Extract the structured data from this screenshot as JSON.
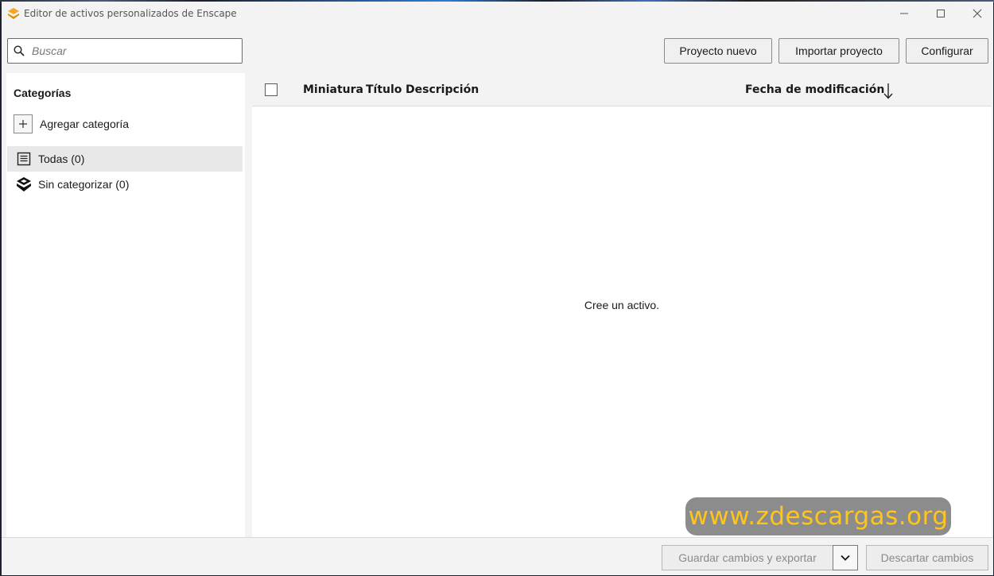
{
  "window": {
    "title": "Editor de activos personalizados de Enscape",
    "accent_color": "#f5a623"
  },
  "toolbar": {
    "search_placeholder": "Buscar",
    "new_project_label": "Proyecto nuevo",
    "import_project_label": "Importar proyecto",
    "configure_label": "Configurar"
  },
  "sidebar": {
    "title": "Categorías",
    "add_category_label": "Agregar categoría",
    "items": [
      {
        "label": "Todas (0)",
        "icon": "list-icon",
        "selected": true
      },
      {
        "label": "Sin categorizar (0)",
        "icon": "enscape-logo-icon",
        "selected": false
      }
    ]
  },
  "table": {
    "columns": [
      "Miniatura",
      "Título",
      "Descripción",
      "Fecha de modificación"
    ],
    "sort_column": "Fecha de modificación",
    "sort_direction": "descending",
    "empty_message": "Cree un activo."
  },
  "watermark": {
    "text": "www.zdescargas.org",
    "color": "#ffc51a"
  },
  "footer": {
    "save_export_label": "Guardar cambios y exportar",
    "discard_label": "Descartar cambios"
  }
}
